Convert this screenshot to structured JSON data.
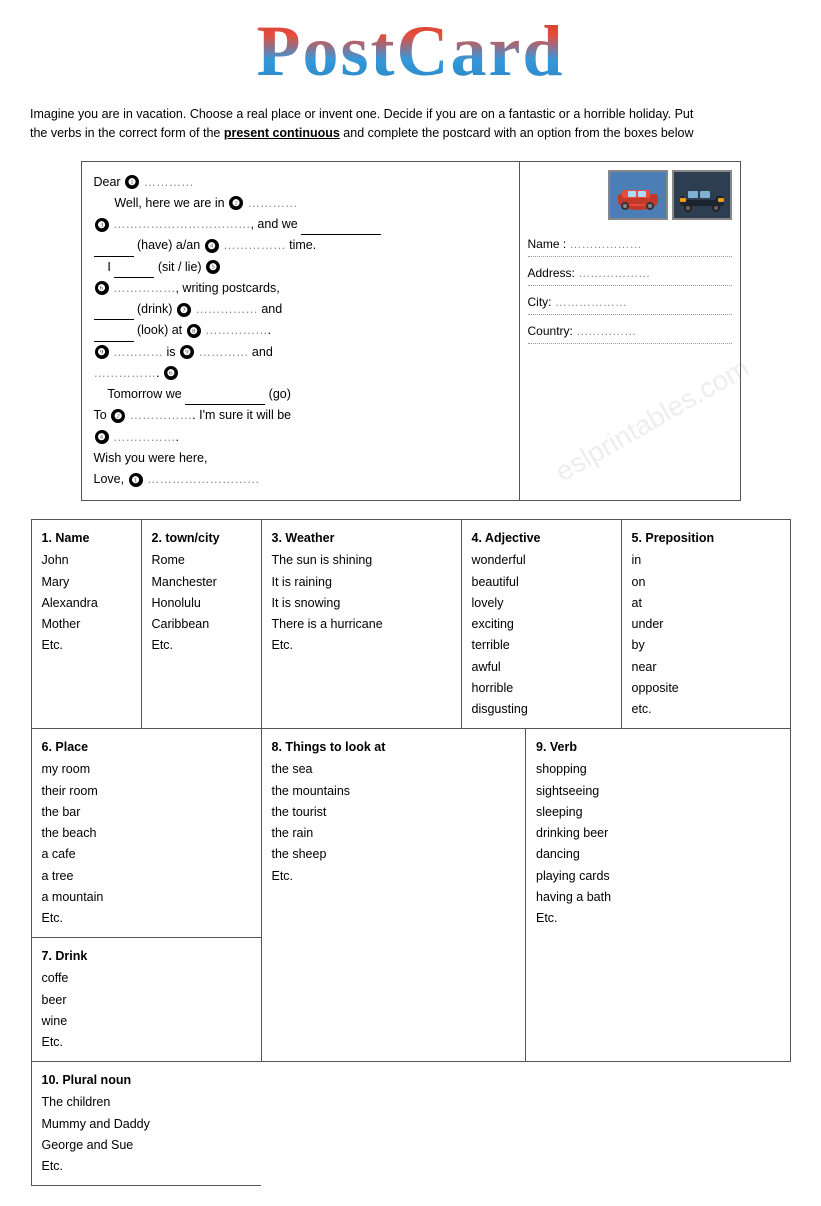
{
  "title": "PostCard",
  "instructions": "Imagine you are in vacation. Choose a real place or invent one. Decide if you are on a fantastic or a horrible holiday. Put the verbs in the correct form of the present continuous and complete the postcard with an option from the boxes below",
  "postcard": {
    "greeting": "Dear",
    "line1": "Well, here we are in",
    "line2": "and we",
    "line3": "(have) a/an",
    "line4": "time.",
    "line5": "I",
    "line5b": "(sit / lie)",
    "line6": ", writing postcards,",
    "line7": "(drink)",
    "line8": "and",
    "line9": "(look) at",
    "line10": "is",
    "line11": "and",
    "line12": "Tomorrow we",
    "line13": "(go)",
    "line14": "I'm sure it will be",
    "line15": "Wish you were here,",
    "line16": "Love,",
    "address": {
      "name_label": "Name :",
      "address_label": "Address:",
      "city_label": "City:",
      "country_label": "Country:"
    }
  },
  "boxes": {
    "box1": {
      "title": "1. Name",
      "items": [
        "John",
        "Mary",
        "Alexandra",
        "Mother",
        "Etc."
      ]
    },
    "box2": {
      "title": "2. town/city",
      "items": [
        "Rome",
        "Manchester",
        "Honolulu",
        "Caribbean",
        "Etc."
      ]
    },
    "box3": {
      "title": "3. Weather",
      "items": [
        "The sun is shining",
        "It is raining",
        "It is snowing",
        "There is a hurricane",
        "Etc."
      ]
    },
    "box4": {
      "title": "4. Adjective",
      "items": [
        "wonderful",
        "beautiful",
        "lovely",
        "exciting",
        "terrible",
        "awful",
        "horrible",
        "disgusting"
      ]
    },
    "box5": {
      "title": "5. Preposition",
      "items": [
        "in",
        "on",
        "at",
        "under",
        "by",
        "near",
        "opposite",
        "etc."
      ]
    },
    "box6": {
      "title": "6. Place",
      "items": [
        "my room",
        "their room",
        "the bar",
        "the beach",
        "a cafe",
        "a tree",
        "a mountain",
        "Etc."
      ]
    },
    "box7": {
      "title": "7. Drink",
      "items": [
        "coffe",
        "beer",
        "wine",
        "Etc."
      ]
    },
    "box8": {
      "title": "8. Things to look at",
      "items": [
        "the sea",
        "the mountains",
        "the tourist",
        "the rain",
        "the sheep",
        "Etc."
      ]
    },
    "box9": {
      "title": "9. Verb",
      "items": [
        "shopping",
        "sightseeing",
        "sleeping",
        "drinking beer",
        "dancing",
        "playing cards",
        "having a bath",
        "Etc."
      ]
    },
    "box10": {
      "title": "10. Plural noun",
      "items": [
        "The children",
        "Mummy and Daddy",
        "George and Sue",
        "Etc."
      ]
    }
  }
}
